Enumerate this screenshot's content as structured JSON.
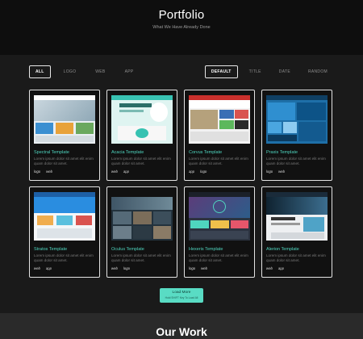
{
  "hero": {
    "title": "Portfolio",
    "subtitle": "What We Have Already Done"
  },
  "filters": [
    "ALL",
    "LOGO",
    "WEB",
    "APP"
  ],
  "sorts": [
    "DEFAULT",
    "TITLE",
    "DATE",
    "RANDOM"
  ],
  "cards": [
    {
      "title": "Spectral Template",
      "desc": "Lorem ipsum dolor sit amet elit enim quam dolor sit amet.",
      "tags": [
        "logo",
        "web"
      ]
    },
    {
      "title": "Acacia Template",
      "desc": "Lorem ipsum dolor sit amet elit enim quam dolor sit amet.",
      "tags": [
        "web",
        "app"
      ]
    },
    {
      "title": "Corvus Template",
      "desc": "Lorem ipsum dolor sit amet elit enim quam dolor sit amet.",
      "tags": [
        "app",
        "logo"
      ]
    },
    {
      "title": "Praxis Template",
      "desc": "Lorem ipsum dolor sit amet elit enim quam dolor sit amet.",
      "tags": [
        "logo",
        "web"
      ]
    },
    {
      "title": "Stratos Template",
      "desc": "Lorem ipsum dolor sit amet elit enim quam dolor sit amet.",
      "tags": [
        "web",
        "app"
      ]
    },
    {
      "title": "Oculus Template",
      "desc": "Lorem ipsum dolor sit amet elit enim quam dolor sit amet.",
      "tags": [
        "web",
        "logo"
      ]
    },
    {
      "title": "Hexeris Template",
      "desc": "Lorem ipsum dolor sit amet elit enim quam dolor sit amet.",
      "tags": [
        "logo",
        "web"
      ]
    },
    {
      "title": "Alerion Template",
      "desc": "Lorem ipsum dolor sit amet elit enim quam dolor sit amet.",
      "tags": [
        "web",
        "app"
      ]
    }
  ],
  "load_more": {
    "label": "Load More",
    "hint": "Hold SHIFT Key To Load All"
  },
  "footer": {
    "title": "Our Work"
  },
  "colors": {
    "accent": "#59dcc4",
    "title_accent": "#4fd5bf",
    "background": "#1a1a1a"
  }
}
